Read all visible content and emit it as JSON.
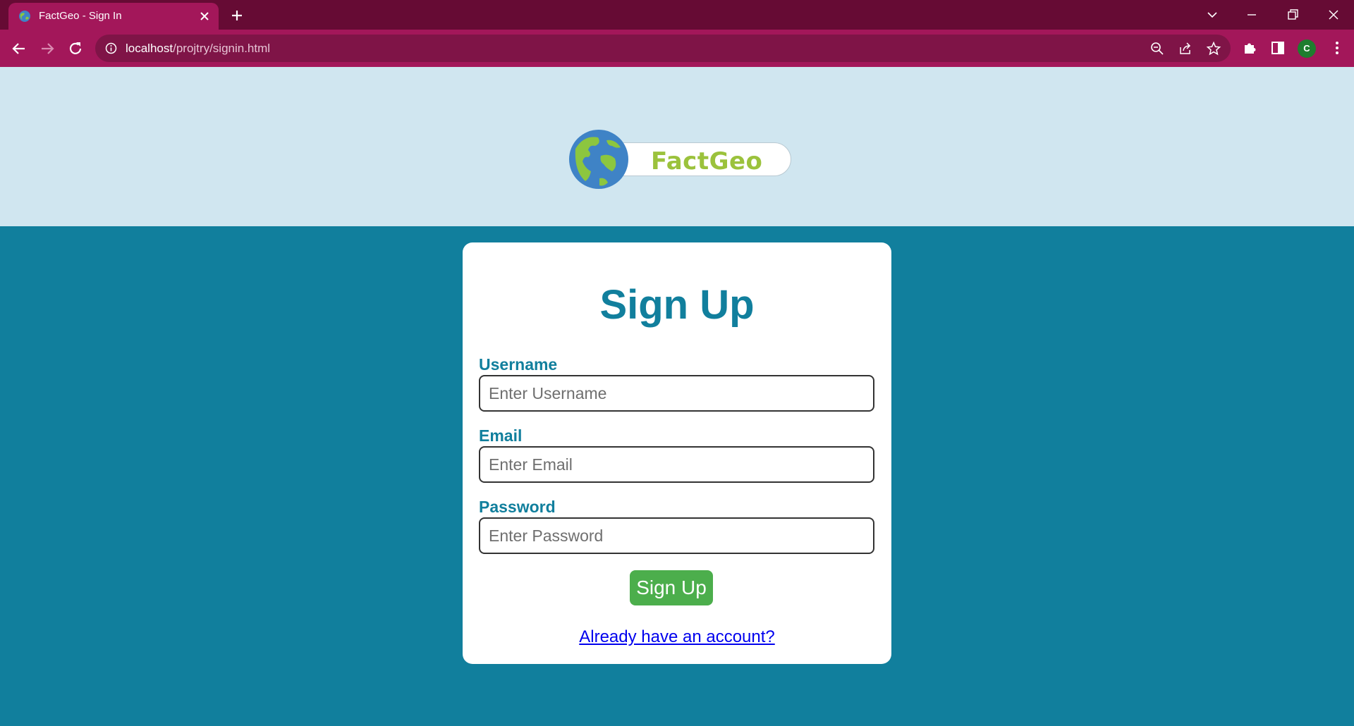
{
  "browser": {
    "tab_title": "FactGeo - Sign In",
    "url_host": "localhost",
    "url_path": "/projtry/signin.html",
    "profile_initial": "C",
    "colors": {
      "tabbar": "#660b34",
      "toolbar": "#a3175a",
      "omnibox": "#7f1447"
    }
  },
  "header": {
    "logo_text": "FactGeo",
    "background": "#d0e6f0"
  },
  "form": {
    "title": "Sign Up",
    "fields": [
      {
        "label": "Username",
        "placeholder": "Enter Username",
        "value": ""
      },
      {
        "label": "Email",
        "placeholder": "Enter Email",
        "value": ""
      },
      {
        "label": "Password",
        "placeholder": "Enter Password",
        "value": ""
      }
    ],
    "submit_label": "Sign Up",
    "login_link": "Already have an account?",
    "colors": {
      "accent": "#117f9d",
      "button": "#4cae4c",
      "link": "#0000ee"
    }
  }
}
